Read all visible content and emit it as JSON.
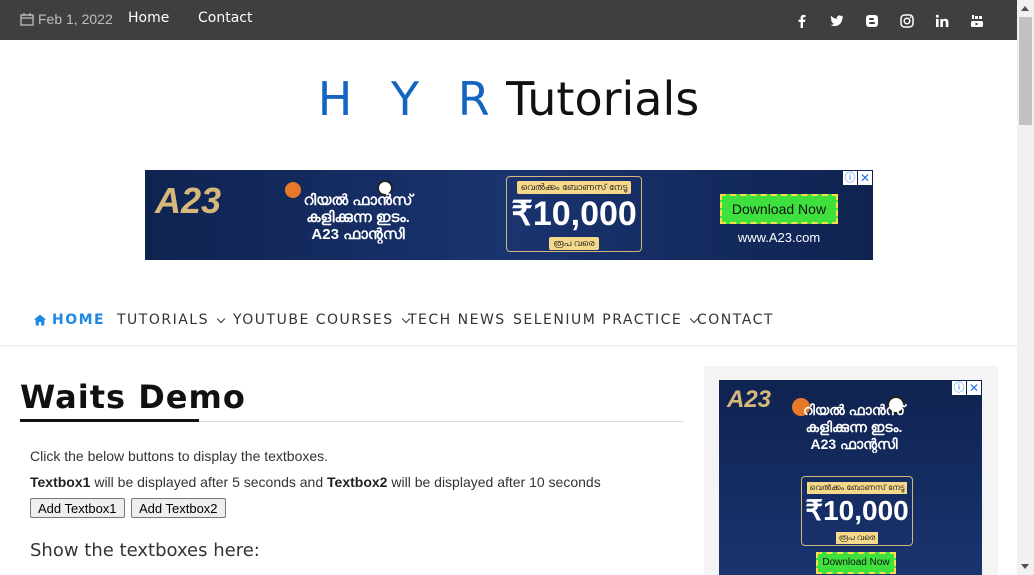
{
  "topbar": {
    "date": "Feb 1, 2022",
    "links": [
      "Home",
      "Contact"
    ],
    "social_icons": [
      "facebook-icon",
      "twitter-icon",
      "blogger-icon",
      "instagram-icon",
      "linkedin-icon",
      "youtube-icon"
    ]
  },
  "logo": {
    "part1": "H Y R",
    "part2": "Tutorials"
  },
  "banner_ad": {
    "brand": "A23",
    "text_line1": "റിയൽ ഫാൻസ്",
    "text_line2": "കളിക്കുന്ന ഇടം.",
    "text_line3": "A23 ഫാന്റസി",
    "bonus_label": "വെൽക്കം ബോണസ് നേടൂ",
    "amount": "₹10,000",
    "amount_suffix": "രൂപ വരെ",
    "download": "Download Now",
    "url": "www.A23.com",
    "info": "ⓘ",
    "close": "✕"
  },
  "nav": {
    "items": [
      "HOME",
      "TUTORIALS",
      "YOUTUBE COURSES",
      "TECH NEWS",
      "SELENIUM PRACTICE",
      "CONTACT"
    ]
  },
  "main": {
    "title": "Waits Demo",
    "intro": "Click the below buttons to display the textboxes.",
    "textbox1_bold": "Textbox1",
    "note_mid": " will be displayed after 5 seconds and ",
    "textbox2_bold": "Textbox2",
    "note_end": " will be displayed after 10 seconds",
    "button1": "Add Textbox1",
    "button2": "Add Textbox2",
    "show_label": "Show the textboxes here:"
  },
  "sidebar_ad": {
    "brand": "A23",
    "text_line1": "റിയൽ ഫാൻസ്",
    "text_line2": "കളിക്കുന്ന ഇടം.",
    "text_line3": "A23 ഫാന്റസി",
    "bonus_label": "വെൽക്കം ബോണസ് നേടൂ",
    "amount": "₹10,000",
    "amount_suffix": "രൂപ വരെ",
    "download": "Download Now",
    "info": "ⓘ",
    "close": "✕"
  },
  "colors": {
    "topbar_bg": "#3f3f3f",
    "logo_blue": "#1565c0",
    "nav_active": "#1e88e5",
    "ad_bg": "#0f2350",
    "ad_gold": "#d6b97a",
    "ad_green": "#3ee03e"
  }
}
